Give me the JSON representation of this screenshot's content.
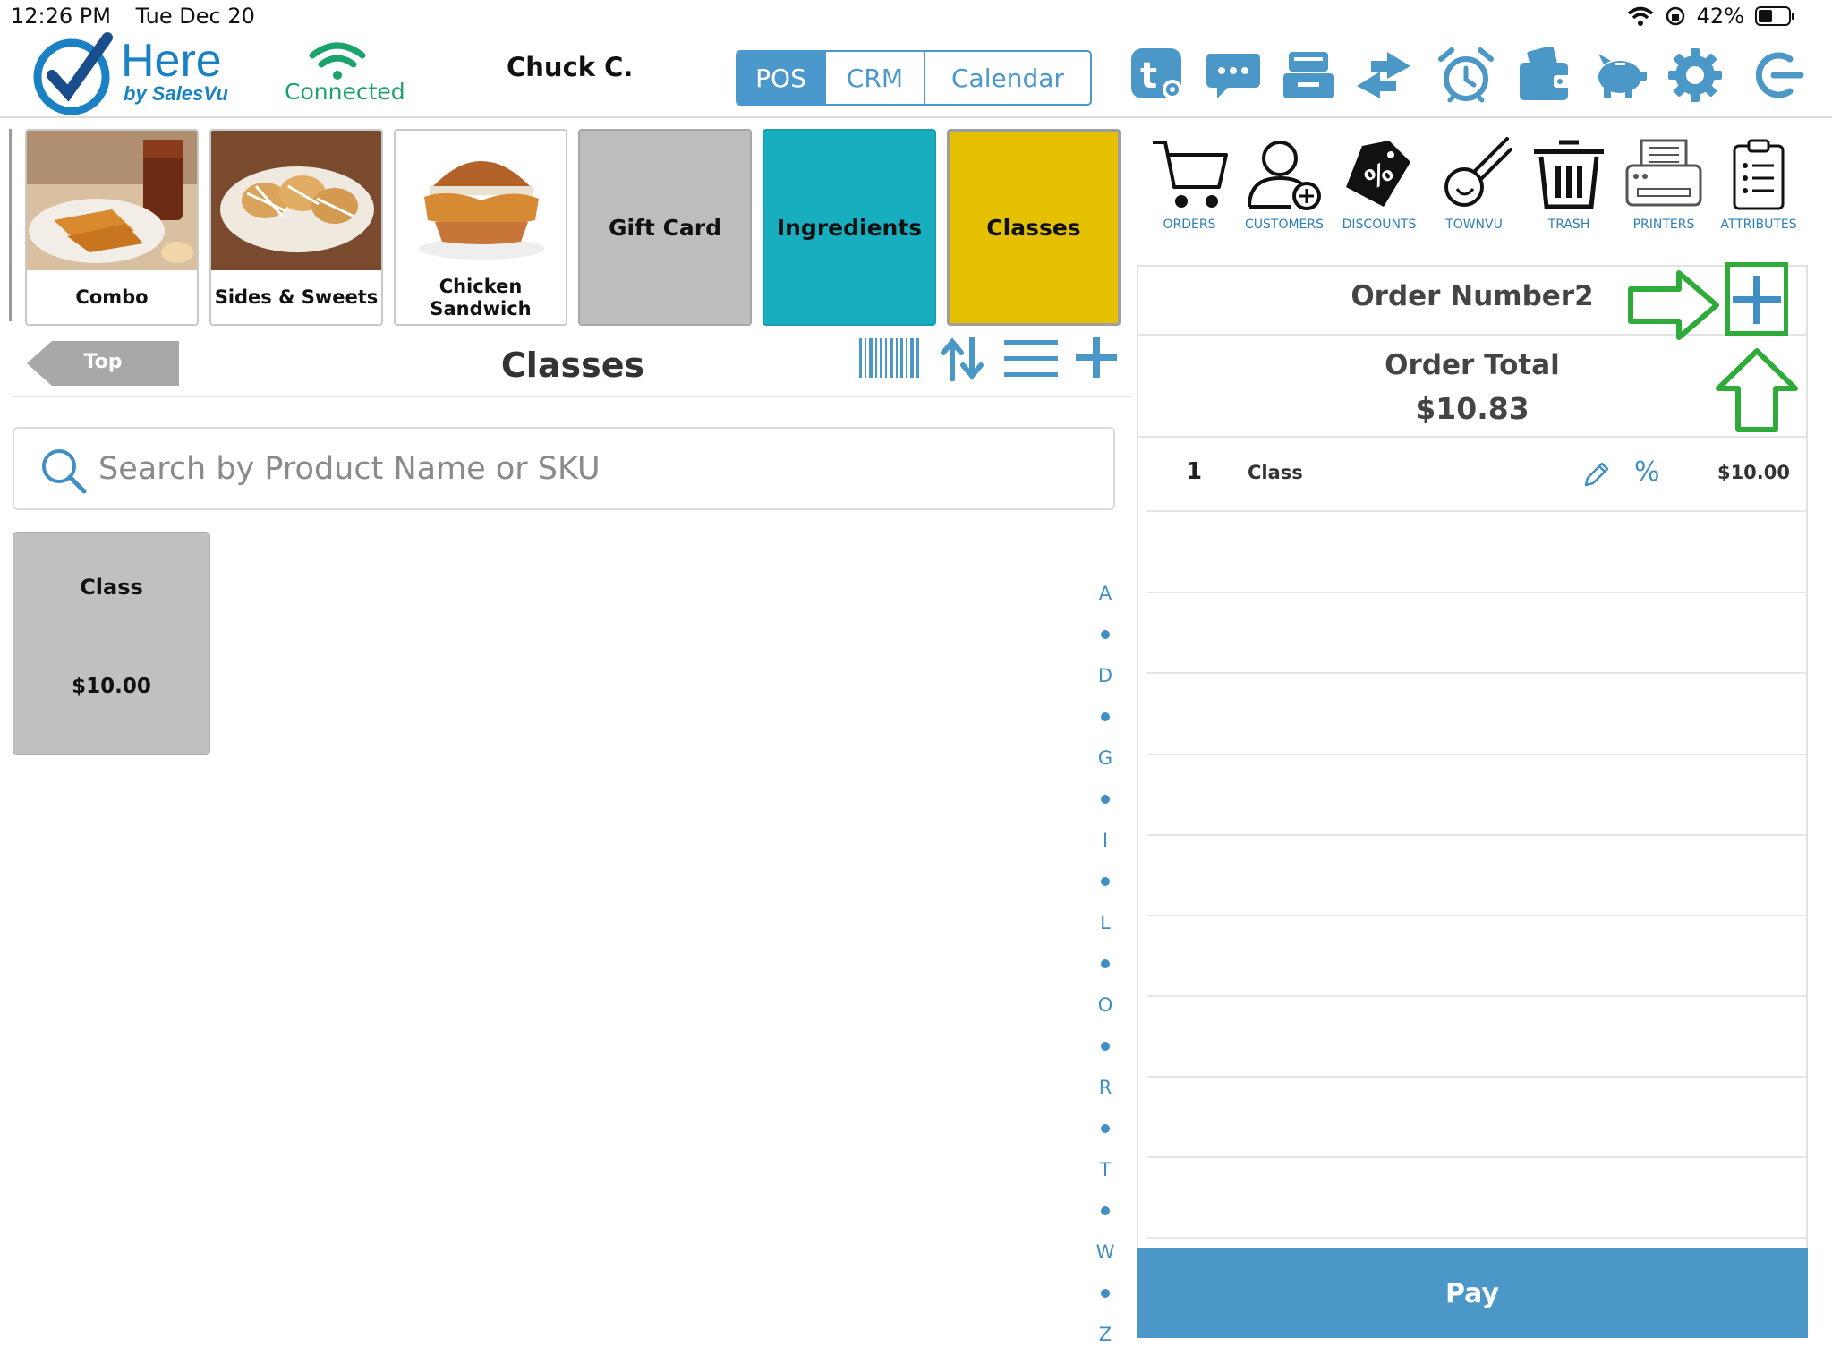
{
  "status_bar": {
    "time": "12:26 PM",
    "date": "Tue Dec 20",
    "battery": "42%"
  },
  "header": {
    "logo_main": "Here",
    "logo_sub": "by SalesVu",
    "connection": "Connected",
    "user": "Chuck C.",
    "tabs": [
      {
        "label": "POS",
        "active": true
      },
      {
        "label": "CRM",
        "active": false
      },
      {
        "label": "Calendar",
        "active": false
      }
    ]
  },
  "categories": [
    {
      "label": "Combo"
    },
    {
      "label": "Sides & Sweets"
    },
    {
      "label": "Chicken Sandwich"
    },
    {
      "label": "Gift Card",
      "color": "#bdbdbd"
    },
    {
      "label": "Ingredients",
      "color": "#17aebf"
    },
    {
      "label": "Classes",
      "color": "#e5c000"
    }
  ],
  "toolbar": {
    "top_label": "Top",
    "section_title": "Classes"
  },
  "search": {
    "placeholder": "Search by Product Name or SKU"
  },
  "products": [
    {
      "name": "Class",
      "price": "$10.00"
    }
  ],
  "alpha_index": [
    "A",
    "D",
    "G",
    "I",
    "L",
    "O",
    "R",
    "T",
    "W",
    "Z"
  ],
  "actions": [
    {
      "label": "ORDERS",
      "icon": "cart-icon"
    },
    {
      "label": "CUSTOMERS",
      "icon": "add-customer-icon"
    },
    {
      "label": "DISCOUNTS",
      "icon": "discount-tag-icon"
    },
    {
      "label": "TOWNVU",
      "icon": "townvu-icon"
    },
    {
      "label": "TRASH",
      "icon": "trash-icon"
    },
    {
      "label": "PRINTERS",
      "icon": "printer-icon"
    },
    {
      "label": "ATTRIBUTES",
      "icon": "clipboard-icon"
    }
  ],
  "order": {
    "number_label": "Order Number2",
    "total_label": "Order Total",
    "total_value": "$10.83",
    "items": [
      {
        "qty": "1",
        "name": "Class",
        "discount_symbol": "%",
        "price": "$10.00"
      }
    ],
    "pay_label": "Pay"
  },
  "colors": {
    "accent": "#4a97c8",
    "annotation": "#2fab3a"
  }
}
